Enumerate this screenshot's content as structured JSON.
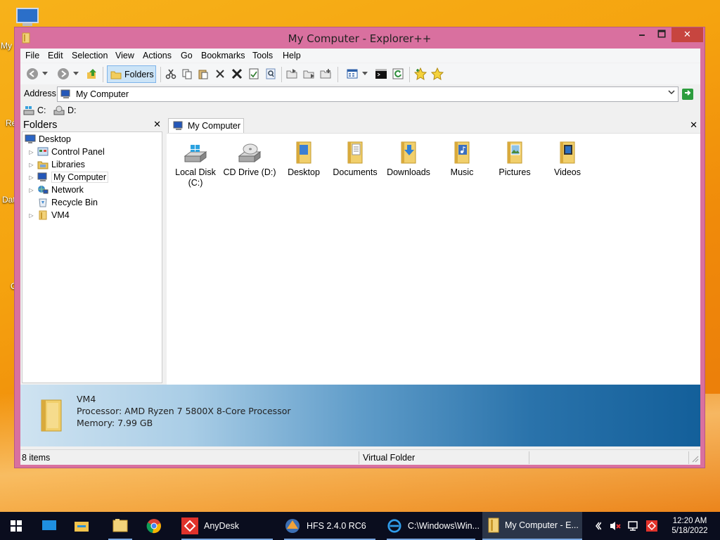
{
  "desktop": {
    "fragments": [
      "My",
      "Re",
      "Dat",
      "C"
    ]
  },
  "window": {
    "title": "My Computer - Explorer++",
    "min_glyph": "🗕",
    "max_glyph": "🗖",
    "close_glyph": "✕"
  },
  "menu": [
    "File",
    "Edit",
    "Selection",
    "View",
    "Actions",
    "Go",
    "Bookmarks",
    "Tools",
    "Help"
  ],
  "toolbar": {
    "folders_label": "Folders"
  },
  "address": {
    "label": "Address",
    "value": "My Computer"
  },
  "drives": [
    "C:",
    "D:"
  ],
  "folders_pane": {
    "title": "Folders",
    "close_glyph": "✕",
    "tree": [
      {
        "label": "Desktop",
        "icon": "desktop-icon"
      },
      {
        "label": "Control Panel",
        "icon": "control-panel-icon"
      },
      {
        "label": "Libraries",
        "icon": "libraries-icon"
      },
      {
        "label": "My Computer",
        "icon": "computer-icon"
      },
      {
        "label": "Network",
        "icon": "network-icon"
      },
      {
        "label": "Recycle Bin",
        "icon": "recycle-bin-icon"
      },
      {
        "label": "VM4",
        "icon": "folder-icon"
      }
    ]
  },
  "tab": {
    "label": "My Computer",
    "close_glyph": "✕"
  },
  "items": [
    {
      "label": "Local Disk (C:)",
      "icon": "local-disk-icon"
    },
    {
      "label": "CD Drive (D:)",
      "icon": "cd-drive-icon"
    },
    {
      "label": "Desktop",
      "icon": "desktop-folder-icon"
    },
    {
      "label": "Documents",
      "icon": "documents-folder-icon"
    },
    {
      "label": "Downloads",
      "icon": "downloads-folder-icon"
    },
    {
      "label": "Music",
      "icon": "music-folder-icon"
    },
    {
      "label": "Pictures",
      "icon": "pictures-folder-icon"
    },
    {
      "label": "Videos",
      "icon": "videos-folder-icon"
    }
  ],
  "display": {
    "name": "VM4",
    "processor": "Processor: AMD Ryzen 7 5800X 8-Core Processor",
    "memory": "Memory: 7.99 GB"
  },
  "status": {
    "count": "8 items",
    "type": "Virtual Folder"
  },
  "taskbar": {
    "apps": [
      {
        "label": "AnyDesk"
      },
      {
        "label": "HFS 2.4.0 RC6"
      },
      {
        "label": "C:\\Windows\\Win..."
      },
      {
        "label": "My Computer - E..."
      }
    ],
    "time": "12:20 AM",
    "date": "5/18/2022"
  },
  "colors": {
    "window_border": "#d9709f",
    "accent_blue": "#135f9a",
    "taskbar_bg": "#0a0d1e"
  }
}
